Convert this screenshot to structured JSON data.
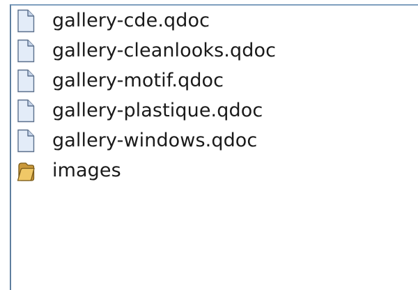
{
  "file_list": {
    "items": [
      {
        "label": "gallery-cde.qdoc",
        "icon": "document-icon"
      },
      {
        "label": "gallery-cleanlooks.qdoc",
        "icon": "document-icon"
      },
      {
        "label": "gallery-motif.qdoc",
        "icon": "document-icon"
      },
      {
        "label": "gallery-plastique.qdoc",
        "icon": "document-icon"
      },
      {
        "label": "gallery-windows.qdoc",
        "icon": "document-icon"
      },
      {
        "label": "images",
        "icon": "folder-icon"
      }
    ]
  }
}
